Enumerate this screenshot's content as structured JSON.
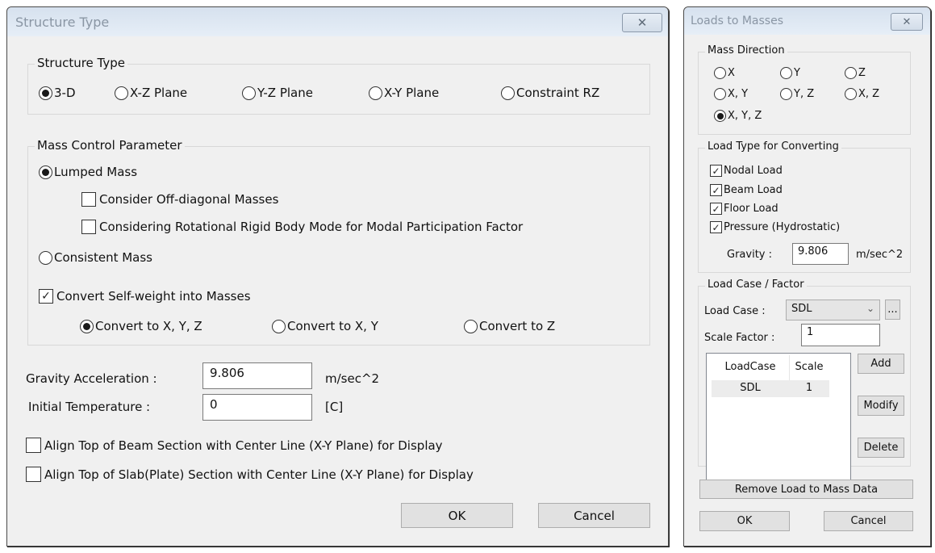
{
  "structure_type_dialog": {
    "title": "Structure Type",
    "close_icon": "close-x",
    "structure_type_group": {
      "legend": "Structure Type",
      "options": [
        {
          "label": "3-D",
          "selected": true
        },
        {
          "label": "X-Z Plane",
          "selected": false
        },
        {
          "label": "Y-Z Plane",
          "selected": false
        },
        {
          "label": "X-Y Plane",
          "selected": false
        },
        {
          "label": "Constraint RZ",
          "selected": false
        }
      ]
    },
    "mass_control_group": {
      "legend": "Mass Control Parameter",
      "lumped_mass": {
        "label": "Lumped Mass",
        "selected": true
      },
      "off_diagonal": {
        "label": "Consider Off-diagonal Masses",
        "checked": false
      },
      "rotational_rigid": {
        "label": "Considering Rotational Rigid Body Mode for Modal Participation Factor",
        "checked": false
      },
      "consistent_mass": {
        "label": "Consistent Mass",
        "selected": false
      },
      "convert_self_weight": {
        "label": "Convert Self-weight into Masses",
        "checked": true
      },
      "convert_options": [
        {
          "label": "Convert to X, Y, Z",
          "selected": true
        },
        {
          "label": "Convert to X, Y",
          "selected": false
        },
        {
          "label": "Convert to Z",
          "selected": false
        }
      ]
    },
    "gravity": {
      "label": "Gravity Acceleration :",
      "value": "9.806",
      "unit": "m/sec^2"
    },
    "initial_temperature": {
      "label": "Initial Temperature :",
      "value": "0",
      "unit": "[C]"
    },
    "align_beam": {
      "label": "Align Top of Beam Section with Center Line (X-Y Plane) for  Display",
      "checked": false
    },
    "align_slab": {
      "label": "Align Top of Slab(Plate) Section with Center Line (X-Y Plane) for Display",
      "checked": false
    },
    "ok_label": "OK",
    "cancel_label": "Cancel"
  },
  "loads_to_masses_dialog": {
    "title": "Loads to Masses",
    "close_icon": "close-x",
    "mass_direction_group": {
      "legend": "Mass Direction",
      "options": [
        {
          "label": "X",
          "selected": false
        },
        {
          "label": "Y",
          "selected": false
        },
        {
          "label": "Z",
          "selected": false
        },
        {
          "label": "X, Y",
          "selected": false
        },
        {
          "label": "Y, Z",
          "selected": false
        },
        {
          "label": "X, Z",
          "selected": false
        },
        {
          "label": "X, Y, Z",
          "selected": true
        }
      ]
    },
    "load_type_group": {
      "legend": "Load Type for Converting",
      "options": [
        {
          "label": "Nodal Load",
          "checked": true
        },
        {
          "label": "Beam Load",
          "checked": true
        },
        {
          "label": "Floor Load",
          "checked": true
        },
        {
          "label": "Pressure (Hydrostatic)",
          "checked": true
        }
      ],
      "gravity_label": "Gravity :",
      "gravity_value": "9.806",
      "gravity_unit": "m/sec^2"
    },
    "load_case_group": {
      "legend": "Load Case / Factor",
      "load_case_label": "Load Case :",
      "load_case_value": "SDL",
      "more_button": "...",
      "scale_factor_label": "Scale Factor :",
      "scale_factor_value": "1",
      "table": {
        "columns": [
          "LoadCase",
          "Scale"
        ],
        "rows": [
          [
            "SDL",
            "1"
          ]
        ]
      },
      "add_label": "Add",
      "modify_label": "Modify",
      "delete_label": "Delete"
    },
    "remove_label": "Remove Load to Mass Data",
    "ok_label": "OK",
    "cancel_label": "Cancel"
  }
}
